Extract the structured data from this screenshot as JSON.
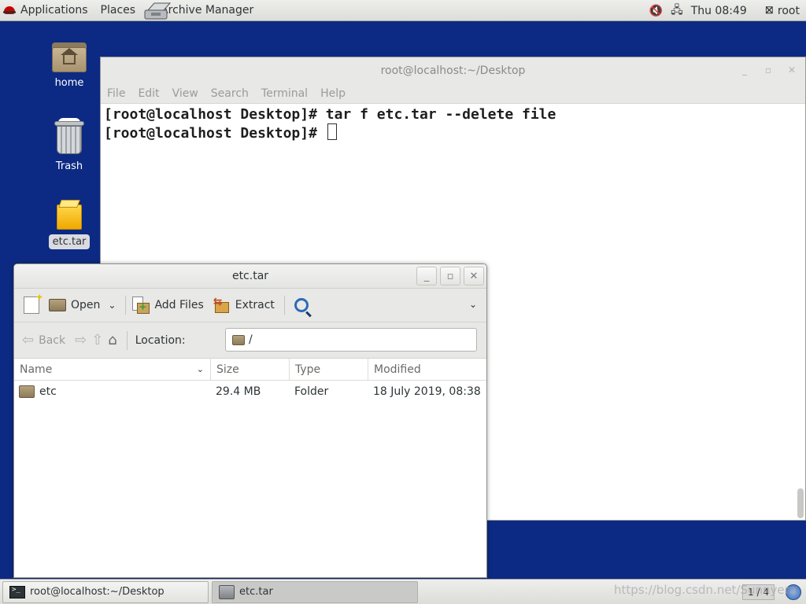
{
  "top_panel": {
    "applications": "Applications",
    "places": "Places",
    "active_app": "Archive Manager",
    "clock": "Thu 08:49",
    "user": "root",
    "tray": {
      "volume_icon": "volume-icon",
      "network_icon": "network-icon"
    }
  },
  "desktop": {
    "icons": [
      {
        "label": "home",
        "icon": "home-folder-icon"
      },
      {
        "label": "Trash",
        "icon": "trash-icon"
      },
      {
        "label": "etc.tar",
        "icon": "tar-archive-icon"
      }
    ]
  },
  "terminal": {
    "title": "root@localhost:~/Desktop",
    "menu": [
      "File",
      "Edit",
      "View",
      "Search",
      "Terminal",
      "Help"
    ],
    "lines": [
      "[root@localhost Desktop]# tar f etc.tar --delete file",
      "[root@localhost Desktop]# "
    ]
  },
  "archiver": {
    "title": "etc.tar",
    "toolbar": {
      "open": "Open",
      "add_files": "Add Files",
      "extract": "Extract"
    },
    "nav": {
      "back": "Back",
      "location_label": "Location:",
      "location_value": "/"
    },
    "columns": [
      "Name",
      "Size",
      "Type",
      "Modified"
    ],
    "rows": [
      {
        "name": "etc",
        "size": "29.4 MB",
        "type": "Folder",
        "modified": "18 July 2019, 08:38"
      }
    ]
  },
  "bottom_panel": {
    "tasks": [
      {
        "label": "root@localhost:~/Desktop"
      },
      {
        "label": "etc.tar"
      }
    ],
    "workspace": "1 / 4",
    "watermark": "https://blog.csdn.net/Sunnyera"
  }
}
